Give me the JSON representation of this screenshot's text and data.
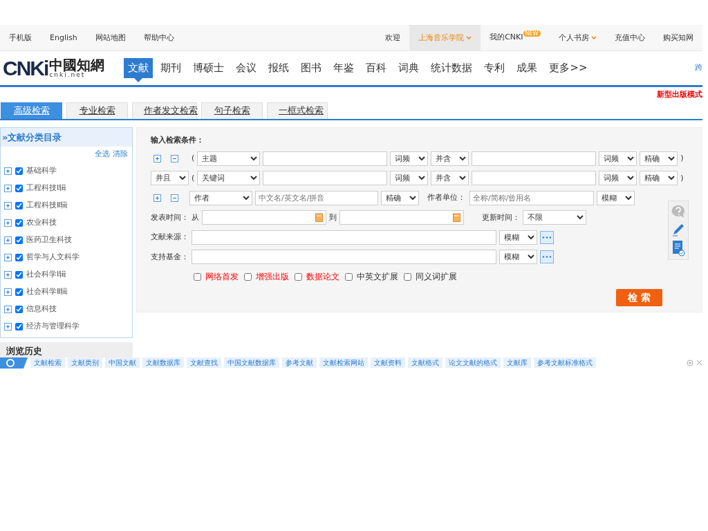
{
  "top_links": [
    "手机版",
    "English",
    "网站地图",
    "帮助中心"
  ],
  "user_menu": [
    {
      "label": "欢迎",
      "kind": "text"
    },
    {
      "label": "上海音乐学院",
      "kind": "dropdown",
      "selected": true
    },
    {
      "label": "我的CNKI",
      "kind": "badge",
      "badge": "NEW"
    },
    {
      "label": "个人书房",
      "kind": "dropdown",
      "selected": false
    },
    {
      "label": "充值中心",
      "kind": "link"
    },
    {
      "label": "购买知网",
      "kind": "link"
    }
  ],
  "logo": {
    "mark": "CNKi",
    "name": "中國知網",
    "domain": "cnki.net"
  },
  "nav": [
    {
      "label": "文献",
      "selected": true
    },
    {
      "label": "期刊",
      "selected": false
    },
    {
      "label": "博硕士",
      "selected": false
    },
    {
      "label": "会议",
      "selected": false
    },
    {
      "label": "报纸",
      "selected": false
    },
    {
      "label": "图书",
      "selected": false
    },
    {
      "label": "年鉴",
      "selected": false
    },
    {
      "label": "百科",
      "selected": false
    },
    {
      "label": "词典",
      "selected": false
    },
    {
      "label": "统计数据",
      "selected": false
    },
    {
      "label": "专利",
      "selected": false
    },
    {
      "label": "成果",
      "selected": false
    },
    {
      "label": "更多>>",
      "selected": false
    }
  ],
  "nav_cut": "跨",
  "notice": "新型出版模式",
  "search_tabs": [
    {
      "label": "高级检索",
      "selected": true
    },
    {
      "label": "专业检索",
      "selected": false
    },
    {
      "label": "作者发文检索",
      "selected": false
    },
    {
      "label": "句子检索",
      "selected": false
    },
    {
      "label": "一框式检索",
      "selected": false
    }
  ],
  "sidebar": {
    "title": "»文献分类目录",
    "actions": [
      "全选",
      "清除"
    ],
    "items": [
      {
        "label": "基础科学",
        "checked": true
      },
      {
        "label": "工程科技Ⅰ辑",
        "checked": true
      },
      {
        "label": "工程科技Ⅱ辑",
        "checked": true
      },
      {
        "label": "农业科技",
        "checked": true
      },
      {
        "label": "医药卫生科技",
        "checked": true
      },
      {
        "label": "哲学与人文科学",
        "checked": true
      },
      {
        "label": "社会科学Ⅰ辑",
        "checked": true
      },
      {
        "label": "社会科学Ⅱ辑",
        "checked": true
      },
      {
        "label": "信息科技",
        "checked": true
      },
      {
        "label": "经济与管理科学",
        "checked": true
      }
    ],
    "history_title": "浏览历史"
  },
  "form": {
    "heading": "输入检索条件：",
    "conditions": [
      {
        "open": "(",
        "field": "主题",
        "freq": "词频",
        "join": "并含",
        "freq2": "词频",
        "match": "精确",
        "close": ")"
      },
      {
        "logic": "并且",
        "open": "(",
        "field": "关键词",
        "freq": "词频",
        "join": "并含",
        "freq2": "词频",
        "match": "精确",
        "close": ")"
      }
    ],
    "author": {
      "field": "作者",
      "placeholder": "中文名/英文名/拼音",
      "match": "精确",
      "unit_label": "作者单位：",
      "unit_placeholder": "全称/简称/曾用名",
      "unit_match": "模糊"
    },
    "date": {
      "label": "发表时间：",
      "from": "从",
      "to": "到",
      "update_label": "更新时间：",
      "update_value": "不限"
    },
    "sources": [
      {
        "label": "文献来源：",
        "match": "模糊"
      },
      {
        "label": "支持基金：",
        "match": "模糊"
      }
    ],
    "options": [
      {
        "label": "网络首发",
        "checked": false,
        "kind": "highlight"
      },
      {
        "label": "增强出版",
        "checked": false,
        "kind": "highlight"
      },
      {
        "label": "数据论文",
        "checked": false,
        "kind": "highlight"
      },
      {
        "label": "中英文扩展",
        "checked": false,
        "kind": "plain"
      },
      {
        "label": "同义词扩展",
        "checked": false,
        "kind": "plain"
      }
    ],
    "submit": "检 索"
  },
  "related": [
    "文献检索",
    "文献类别",
    "中国文献",
    "文献数据库",
    "文献查找",
    "中国文献数据库",
    "参考文献",
    "文献检索网站",
    "文献资料",
    "文献格式",
    "论文文献的格式",
    "文献库",
    "参考文献标准格式"
  ]
}
